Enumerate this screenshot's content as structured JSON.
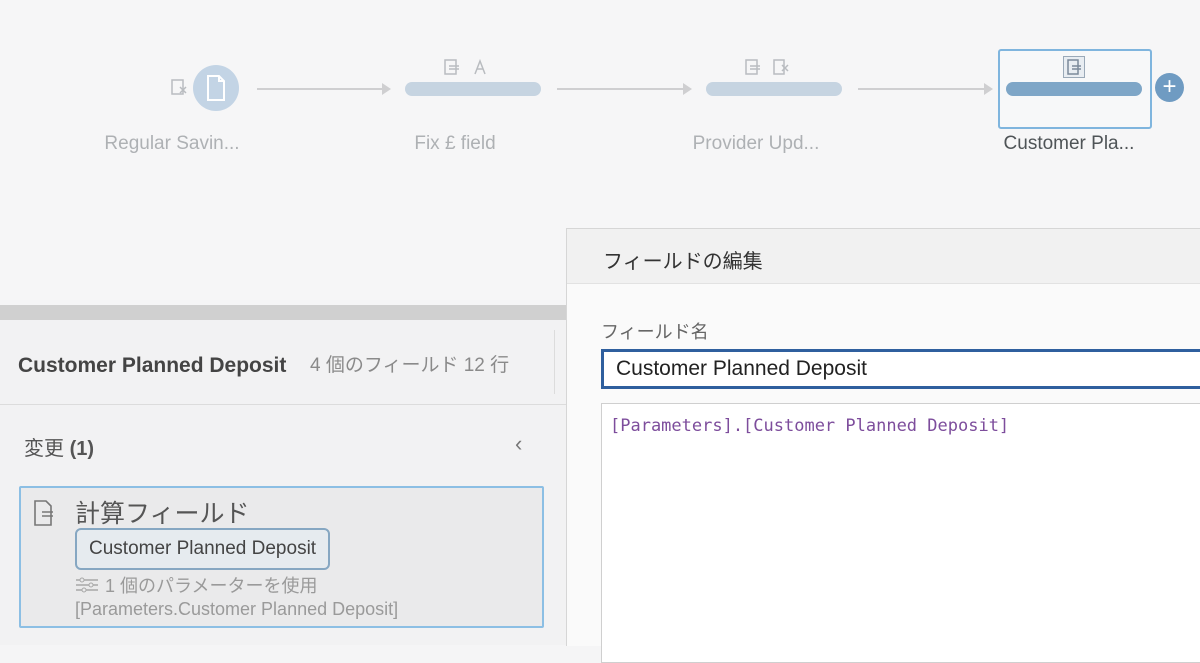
{
  "flow": {
    "steps": [
      {
        "label": "Regular Savin...",
        "icon": "file-icon"
      },
      {
        "label": "Fix £ field",
        "icons": [
          "calc-icon",
          "rename-icon"
        ]
      },
      {
        "label": "Provider Upd...",
        "icons": [
          "calc-icon",
          "remove-icon"
        ]
      },
      {
        "label": "Customer Pla...",
        "icons": [
          "calc-icon"
        ],
        "active": true
      }
    ],
    "add_button": "+"
  },
  "profile": {
    "title": "Customer Planned Deposit",
    "meta": "4 個のフィールド  12 行"
  },
  "changes": {
    "title": "変更",
    "count": "(1)",
    "collapse_glyph": "‹",
    "card": {
      "title": "計算フィールド",
      "field": "Customer Planned Deposit",
      "param_usage": "1 個のパラメーターを使用",
      "param_ref": "[Parameters.Customer Planned Deposit]"
    }
  },
  "editor": {
    "title": "フィールドの編集",
    "field_name_label": "フィールド名",
    "field_name_value": "Customer Planned Deposit",
    "formula": "[Parameters].[Customer Planned Deposit]"
  },
  "colors": {
    "accent": "#2f5f9e",
    "selection": "#8cbfe4",
    "formula_text": "#7d4d9c"
  }
}
